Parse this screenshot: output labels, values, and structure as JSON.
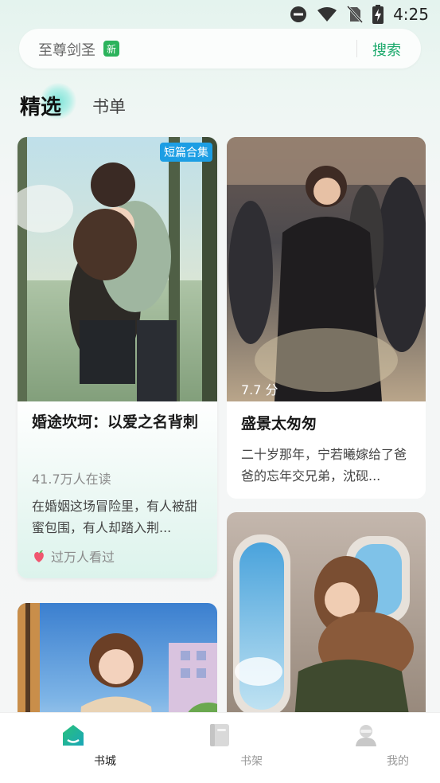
{
  "status": {
    "time": "4:25"
  },
  "search": {
    "text": "至尊剑圣",
    "badge": "新",
    "button": "搜索"
  },
  "tabs": [
    {
      "label": "精选"
    },
    {
      "label": "书单"
    }
  ],
  "cards": [
    {
      "badge": "短篇合集",
      "title": "婚途坎坷：以爱之名背刺",
      "readers": "41.7万人在读",
      "desc": "在婚姻这场冒险里，有人被甜蜜包围，有人却踏入荆...",
      "seen": "过万人看过"
    },
    {
      "score": "7.7 分",
      "title": "盛景太匆匆",
      "desc": "二十岁那年，宁若曦嫁给了爸爸的忘年交兄弟，沈砚..."
    }
  ],
  "nav": [
    {
      "label": "书城",
      "icon": "bookstore-home-icon"
    },
    {
      "label": "书架",
      "icon": "bookshelf-icon"
    },
    {
      "label": "我的",
      "icon": "profile-icon"
    }
  ],
  "colors": {
    "accent": "#19a86a",
    "badge_blue": "#1c9ee4",
    "new_green": "#2cb35c"
  }
}
